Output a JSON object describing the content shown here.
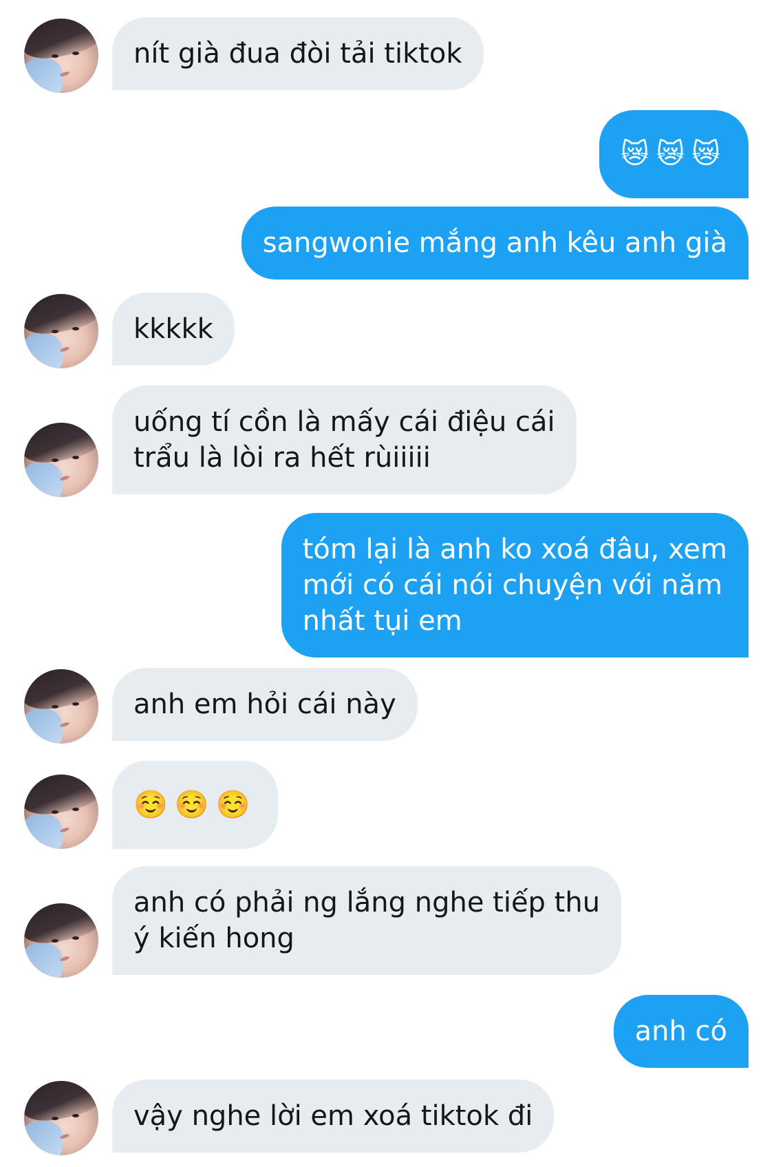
{
  "conversation": {
    "messages": [
      {
        "direction": "incoming",
        "text": "nít già đua đòi tải tiktok"
      },
      {
        "direction": "outgoing",
        "text": "😿😿😿"
      },
      {
        "direction": "outgoing",
        "text": "sangwonie mắng anh kêu anh già"
      },
      {
        "direction": "incoming",
        "text": "kkkkk"
      },
      {
        "direction": "incoming",
        "text": "uống tí cồn là mấy cái điệu cái\ntrẩu là lòi ra hết rùiiiii"
      },
      {
        "direction": "outgoing",
        "text": "tóm lại là anh ko xoá đâu, xem\nmới có cái nói chuyện với năm\nnhất tụi em"
      },
      {
        "direction": "incoming",
        "text": "anh em hỏi cái này"
      },
      {
        "direction": "incoming",
        "text": "☺️☺️☺️"
      },
      {
        "direction": "incoming",
        "text": "anh có phải ng lắng nghe tiếp thu\ný kiến hong"
      },
      {
        "direction": "outgoing",
        "text": "anh có"
      },
      {
        "direction": "incoming",
        "text": "vậy nghe lời em xoá tiktok đi"
      }
    ]
  },
  "colors": {
    "incoming_bubble": "#e6ecf0",
    "outgoing_bubble": "#1da1f2",
    "incoming_text": "#14171a",
    "outgoing_text": "#ffffff"
  }
}
